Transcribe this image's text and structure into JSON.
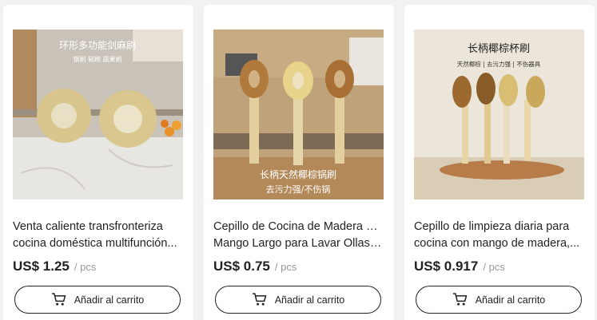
{
  "products": [
    {
      "image_text": [
        "环形多功能剑麻刷",
        "锅刷 碗刷 蔬果刷"
      ],
      "title_line1": "Venta caliente transfronteriza",
      "title_line2": "cocina doméstica multifunción...",
      "price": "US$ 1.25",
      "unit": "/ pcs",
      "cart_label": "Añadir al carrito"
    },
    {
      "image_text": [
        "长柄天然椰棕锅刷",
        "去污力强/不伤锅"
      ],
      "title_line1": "Cepillo de Cocina de Madera con",
      "title_line2": "Mango Largo para Lavar Ollas si...",
      "price": "US$ 0.75",
      "unit": "/ pcs",
      "cart_label": "Añadir al carrito"
    },
    {
      "image_text": [
        "长柄椰棕杯刷",
        "天然椰棕 | 去污力强 | 不伤器具"
      ],
      "title_line1": "Cepillo de limpieza diaria para",
      "title_line2": "cocina con mango de madera,...",
      "price": "US$ 0.917",
      "unit": "/ pcs",
      "cart_label": "Añadir al carrito"
    }
  ]
}
